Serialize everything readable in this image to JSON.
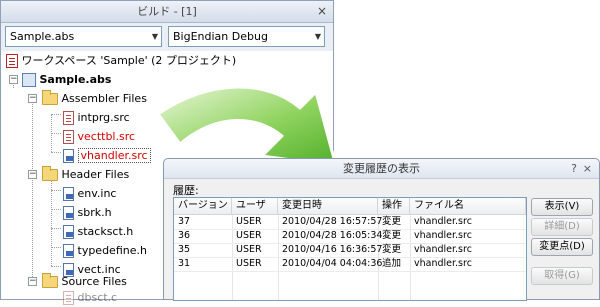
{
  "build_panel": {
    "title": "ビルド - [1]",
    "close_glyph": "×",
    "project_combo": {
      "value": "Sample.abs"
    },
    "config_combo": {
      "value": "BigEndian Debug"
    },
    "tree": {
      "workspace": "ワークスペース 'Sample' (2 プロジェクト)",
      "project": "Sample.abs",
      "folders": [
        {
          "name": "Assembler Files",
          "files": [
            "intprg.src",
            "vecttbl.src",
            "vhandler.src"
          ]
        },
        {
          "name": "Header Files",
          "files": [
            "env.inc",
            "sbrk.h",
            "stacksct.h",
            "typedefine.h",
            "vect.inc"
          ]
        },
        {
          "name": "Source Files",
          "files": [
            "dbsct.c"
          ]
        }
      ],
      "modified_files": [
        "vecttbl.src",
        "vhandler.src"
      ],
      "selected_file": "vhandler.src",
      "expand_glyph": "−"
    }
  },
  "history_dialog": {
    "title": "変更履歴の表示",
    "help_glyph": "?",
    "close_glyph": "×",
    "history_label": "履歴:",
    "columns": [
      "バージョン",
      "ユーザ",
      "変更日時",
      "操作",
      "ファイル名"
    ],
    "rows": [
      [
        "37",
        "USER",
        "2010/04/28 16:57:57",
        "変更",
        "vhandler.src"
      ],
      [
        "36",
        "USER",
        "2010/04/28 16:05:34",
        "変更",
        "vhandler.src"
      ],
      [
        "35",
        "USER",
        "2010/04/16 16:36:57",
        "変更",
        "vhandler.src"
      ],
      [
        "31",
        "USER",
        "2010/04/04 04:04:36",
        "追加",
        "vhandler.src"
      ]
    ],
    "buttons": {
      "view": "表示(V)",
      "details": "詳細(D)",
      "changes": "変更点(D)",
      "get": "取得(G)"
    }
  },
  "colors": {
    "modified_file": "#d40000",
    "arrow_green": "#6cc24a"
  },
  "icons": [
    "close-icon",
    "chevron-down-icon",
    "workspace-icon",
    "project-icon",
    "folder-icon",
    "source-file-icon",
    "header-file-icon",
    "help-icon",
    "arrow-graphic"
  ]
}
